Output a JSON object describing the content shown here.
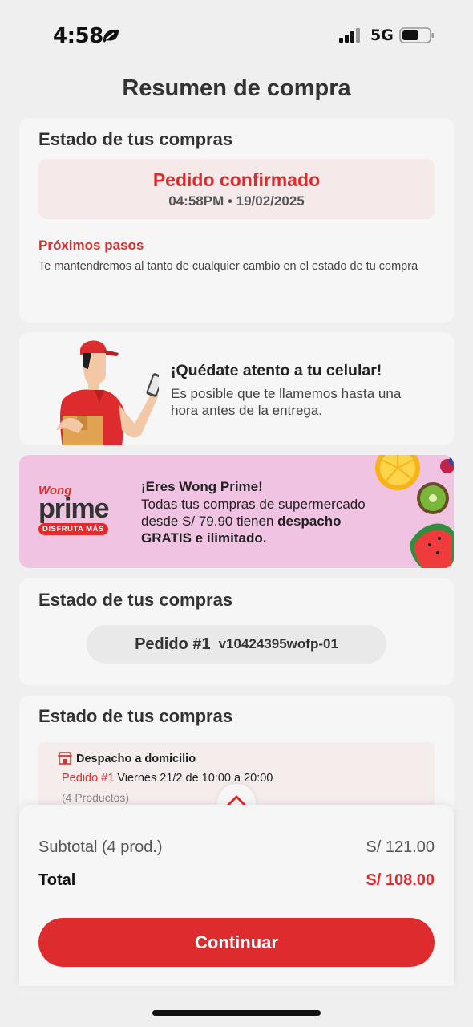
{
  "status_bar": {
    "time": "4:58",
    "network": "5G"
  },
  "page_title": "Resumen de compra",
  "status_card": {
    "heading": "Estado de tus compras",
    "status_title": "Pedido confirmado",
    "status_time": "04:58PM • 19/02/2025",
    "next_title": "Próximos pasos",
    "next_text": "Te mantendremos al tanto de cualquier cambio en el estado de tu compra"
  },
  "phone_tip": {
    "title": "¡Quédate atento a tu celular!",
    "text": "Es posible que te llamemos hasta una hora antes de la entrega."
  },
  "prime_banner": {
    "logo_brand": "Wong",
    "logo_prime": "prime",
    "logo_tag": "DISFRUTA MÁS",
    "title": "¡Eres Wong Prime!",
    "text_a": "Todas tus compras de supermercado desde S/ 79.90 tienen ",
    "text_bold": "despacho GRATIS e ilimitado."
  },
  "orders_card": {
    "heading": "Estado de tus compras",
    "order_label": "Pedido #1",
    "order_code": "v10424395wofp-01"
  },
  "delivery_card": {
    "heading": "Estado de tus compras",
    "delivery_type": "Despacho a domicilio",
    "order_ref": "Pedido #1",
    "schedule": " Viernes 21/2 de 10:00 a 20:00",
    "product_count": "(4 Productos)"
  },
  "summary": {
    "subtotal_label": "Subtotal (4 prod.)",
    "subtotal_value": "S/ 121.00",
    "total_label": "Total",
    "total_value": "S/ 108.00",
    "continue_label": "Continuar"
  },
  "colors": {
    "brand_red": "#de2b2d",
    "banner_pink": "#f1c3e2",
    "background": "#efefef"
  }
}
